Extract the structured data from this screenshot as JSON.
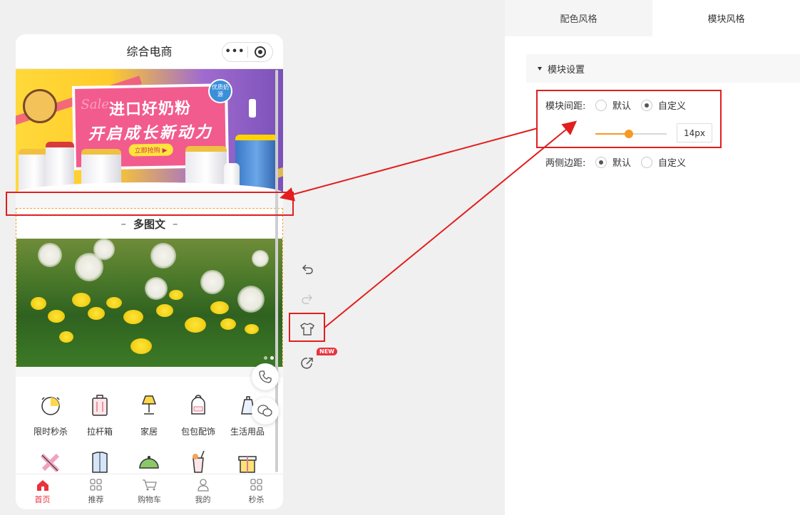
{
  "phone": {
    "title": "综合电商",
    "capsule_dots": "•••",
    "banner": {
      "sale": "Sale",
      "line1": "进口好奶粉",
      "line2": "开启成长新动力",
      "button": "立即抢购 ▶",
      "badge": "优质奶源"
    },
    "module_title": "多图文",
    "module_title_dash_left": "–",
    "module_title_dash_right": "–",
    "categories": [
      {
        "label": "限时秒杀",
        "icon": "clock-icon"
      },
      {
        "label": "拉杆箱",
        "icon": "luggage-icon"
      },
      {
        "label": "家居",
        "icon": "lamp-icon"
      },
      {
        "label": "包包配饰",
        "icon": "bag-icon"
      },
      {
        "label": "生活用品",
        "icon": "kettle-icon"
      }
    ],
    "tabbar": [
      {
        "label": "首页",
        "icon": "home-icon",
        "active": true
      },
      {
        "label": "推荐",
        "icon": "grid-icon",
        "active": false
      },
      {
        "label": "购物车",
        "icon": "cart-icon",
        "active": false
      },
      {
        "label": "我的",
        "icon": "user-icon",
        "active": false
      },
      {
        "label": "秒杀",
        "icon": "grid-icon",
        "active": false
      }
    ]
  },
  "toolbar": {
    "new_badge": "NEW"
  },
  "panel": {
    "tabs": [
      {
        "label": "配色风格",
        "active": false
      },
      {
        "label": "模块风格",
        "active": true
      }
    ],
    "section_title": "模块设置",
    "module_spacing": {
      "label": "模块间距:",
      "options": [
        "默认",
        "自定义"
      ],
      "selected": "自定义",
      "value": "14px",
      "slider_fraction": 0.47
    },
    "side_margin": {
      "label": "两侧边距:",
      "options": [
        "默认",
        "自定义"
      ],
      "selected": "默认"
    }
  },
  "colors": {
    "accent_orange": "#f79a22",
    "active_red": "#e8323c",
    "annotation_red": "#e21e1e"
  }
}
